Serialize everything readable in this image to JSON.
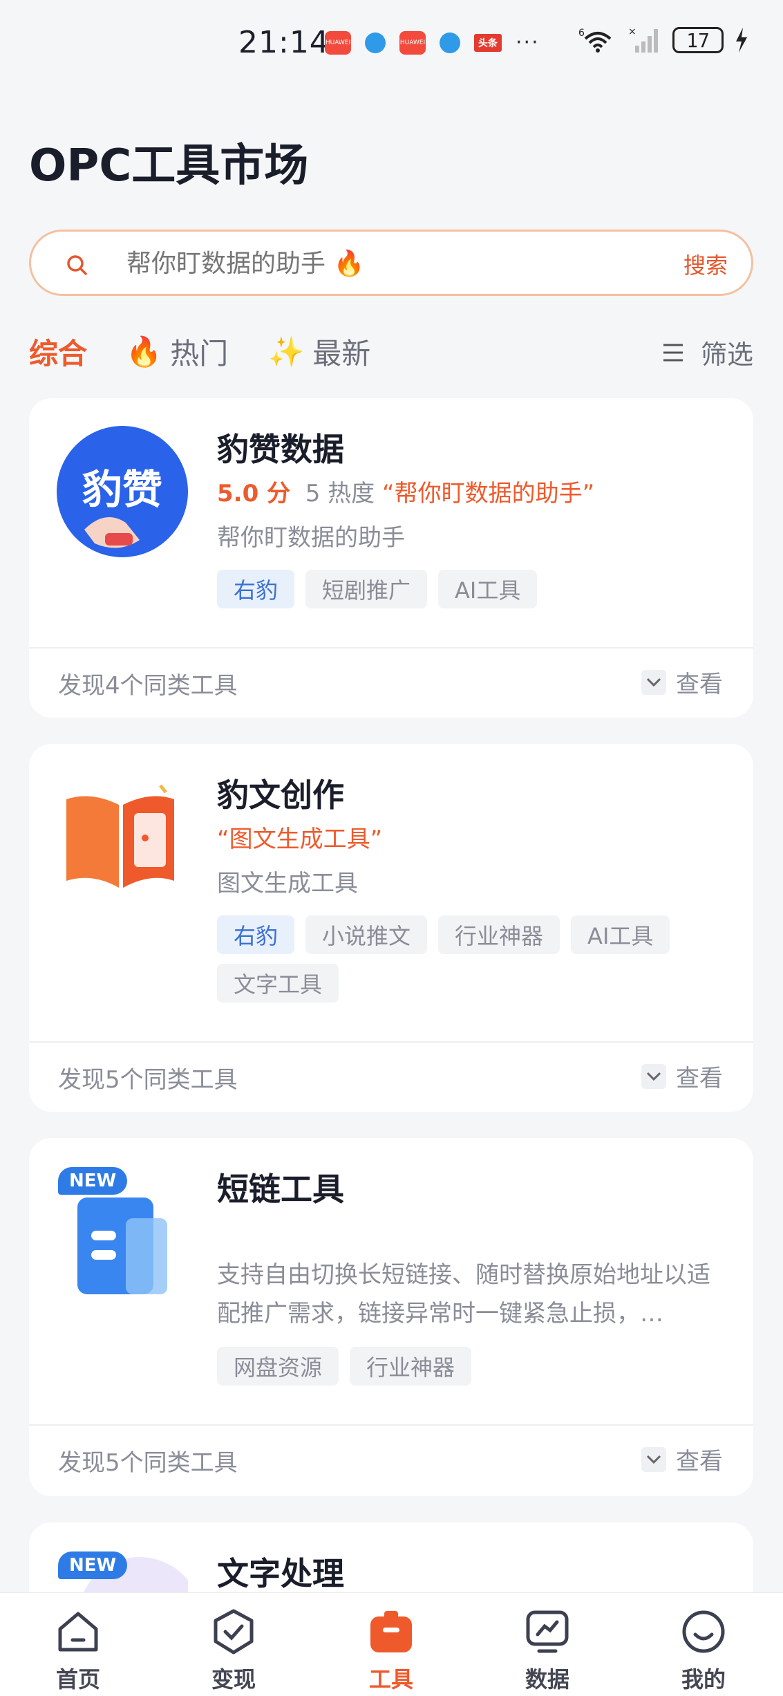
{
  "status_bar": {
    "time": "21:14",
    "app_badge_1": "HUAWEI",
    "app_badge_2": "HUAWEI",
    "news_badge": "头条",
    "more": "···",
    "network": "6",
    "battery": "17"
  },
  "page": {
    "title": "OPC工具市场"
  },
  "search": {
    "placeholder": "帮你盯数据的助手 🔥",
    "button_label": "搜索"
  },
  "tabs": [
    {
      "label": "综合",
      "icon": ""
    },
    {
      "label": "热门",
      "icon": "🔥"
    },
    {
      "label": "最新",
      "icon": "✨"
    }
  ],
  "filter_label": "筛选",
  "cards": [
    {
      "title": "豹赞数据",
      "logo_text": "豹赞",
      "rating": "5.0 分",
      "heat": "5 热度",
      "quote": "“帮你盯数据的助手”",
      "description": "帮你盯数据的助手",
      "tags": [
        "右豹",
        "短剧推广",
        "AI工具"
      ],
      "footer": "发现4个同类工具",
      "view_label": "查看"
    },
    {
      "title": "豹文创作",
      "quote": "“图文生成工具”",
      "description": "图文生成工具",
      "tags": [
        "右豹",
        "小说推文",
        "行业神器",
        "AI工具",
        "文字工具"
      ],
      "footer": "发现5个同类工具",
      "view_label": "查看"
    },
    {
      "title": "短链工具",
      "badge": "NEW",
      "description": "支持自由切换长短链接、随时替换原始地址以适配推广需求，链接异常时一键紧急止损，…",
      "tags": [
        "网盘资源",
        "行业神器"
      ],
      "footer": "发现5个同类工具",
      "view_label": "查看"
    },
    {
      "title": "文字处理",
      "badge": "NEW"
    }
  ],
  "nav": [
    {
      "label": "首页",
      "icon": "home-icon"
    },
    {
      "label": "变现",
      "icon": "check-shield-icon"
    },
    {
      "label": "工具",
      "icon": "toolbox-icon"
    },
    {
      "label": "数据",
      "icon": "chart-monitor-icon"
    },
    {
      "label": "我的",
      "icon": "smile-icon"
    }
  ],
  "colors": {
    "accent": "#ee5a2c",
    "tag_primary": "#3a6fd4",
    "badge_new": "#2f7be6"
  }
}
